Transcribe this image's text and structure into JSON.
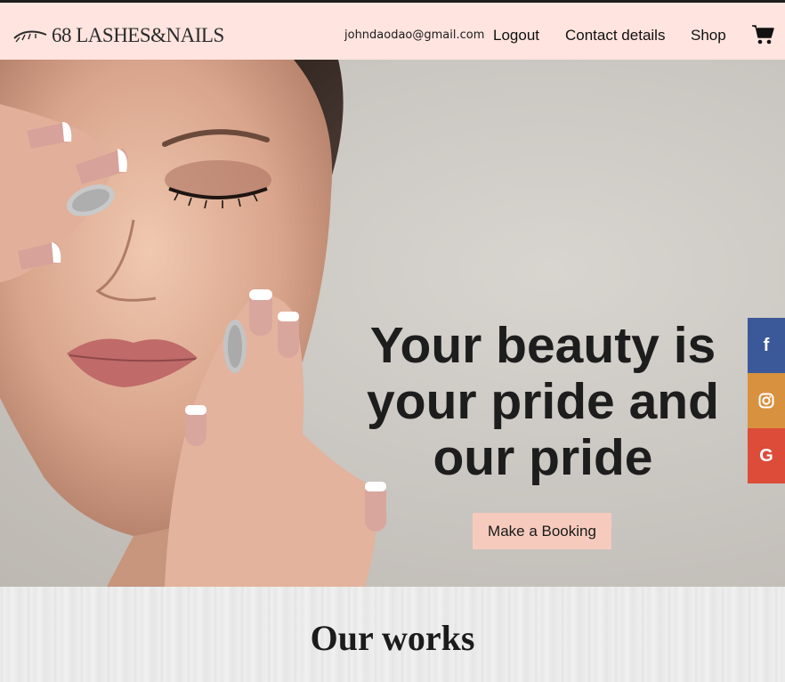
{
  "brand": {
    "logo_text": "68 LASHES&NAILS"
  },
  "nav": {
    "email": "johndaodao@gmail.com",
    "logout": "Logout",
    "contact": "Contact details",
    "shop": "Shop",
    "cart_icon": "cart-icon"
  },
  "hero": {
    "headline_lines": [
      "Your beauty is",
      "your pride and",
      "our pride"
    ],
    "cta": "Make a Booking"
  },
  "social": {
    "facebook": "f",
    "instagram_icon": "instagram-icon",
    "google": "G",
    "colors": {
      "facebook": "#3b5998",
      "instagram": "#d8913f",
      "google": "#dd4b39"
    }
  },
  "section": {
    "title": "Our works"
  },
  "colors": {
    "header_bg": "#ffe4df",
    "button_bg": "#f6cbbd"
  }
}
